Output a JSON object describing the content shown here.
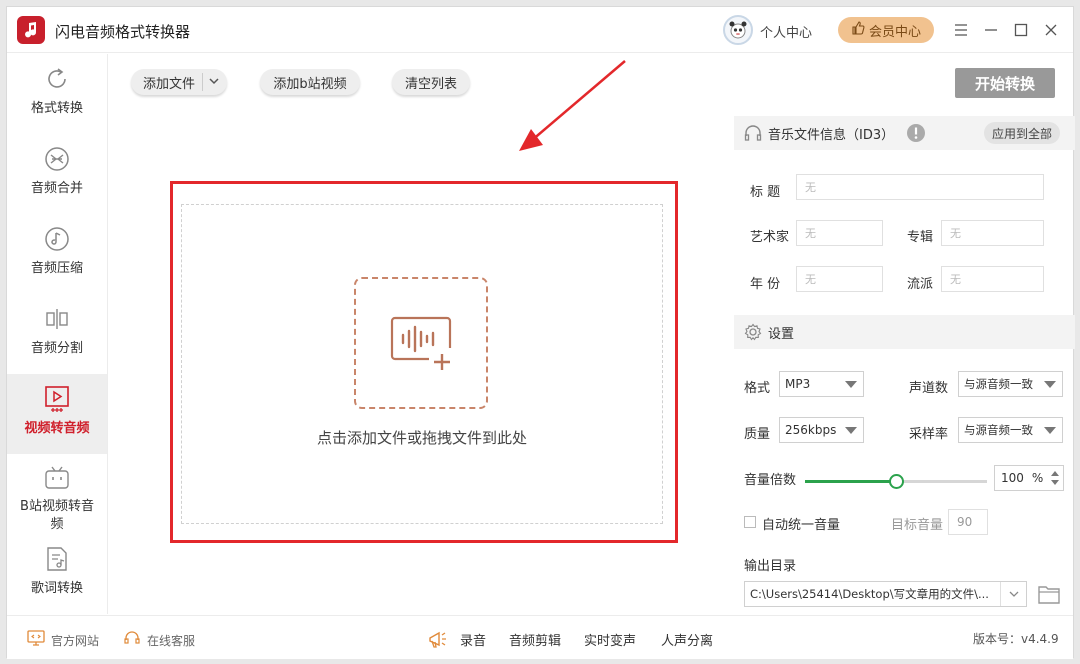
{
  "app": {
    "title": "闪电音频格式转换器",
    "personal_center": "个人中心",
    "vip_center": "会员中心"
  },
  "sidebar": {
    "items": [
      {
        "label": "格式转换",
        "icon": "refresh-icon"
      },
      {
        "label": "音频合并",
        "icon": "merge-icon"
      },
      {
        "label": "音频压缩",
        "icon": "music-note-icon"
      },
      {
        "label": "音频分割",
        "icon": "split-icon"
      },
      {
        "label": "视频转音频",
        "icon": "video-play-icon",
        "active": true
      },
      {
        "label": "B站视频转音频",
        "icon": "bilibili-icon"
      },
      {
        "label": "歌词转换",
        "icon": "lyrics-icon"
      }
    ]
  },
  "toolbar": {
    "add_file": "添加文件",
    "add_bilibili": "添加b站视频",
    "clear_list": "清空列表",
    "start": "开始转换"
  },
  "dropzone": {
    "text": "点击添加文件或拖拽文件到此处"
  },
  "id3": {
    "header": "音乐文件信息（ID3）",
    "apply_all": "应用到全部",
    "title_label": "标 题",
    "artist_label": "艺术家",
    "album_label": "专辑",
    "year_label": "年 份",
    "genre_label": "流派",
    "placeholder": "无"
  },
  "settings": {
    "header": "设置",
    "format_label": "格式",
    "format_value": "MP3",
    "channels_label": "声道数",
    "channels_value": "与源音频一致",
    "quality_label": "质量",
    "quality_value": "256kbps",
    "samplerate_label": "采样率",
    "samplerate_value": "与源音频一致",
    "volume_label": "音量倍数",
    "volume_value": "100",
    "volume_unit": "%",
    "volume_fraction": 0.5,
    "auto_volume_label": "自动统一音量",
    "target_volume_label": "目标音量",
    "target_volume_value": "90",
    "output_label": "输出目录",
    "output_path": "C:\\Users\\25414\\Desktop\\写文章用的文件\\..."
  },
  "bottom": {
    "official_site": "官方网站",
    "online_service": "在线客服",
    "record": "录音",
    "audio_edit": "音频剪辑",
    "realtime_voice": "实时变声",
    "vocal_separation": "人声分离",
    "version": "版本号：v4.4.9"
  },
  "colors": {
    "accent": "#d0202c",
    "highlight_border": "#e3282b",
    "slider": "#2ba24c",
    "vip": "#f1c28f"
  }
}
